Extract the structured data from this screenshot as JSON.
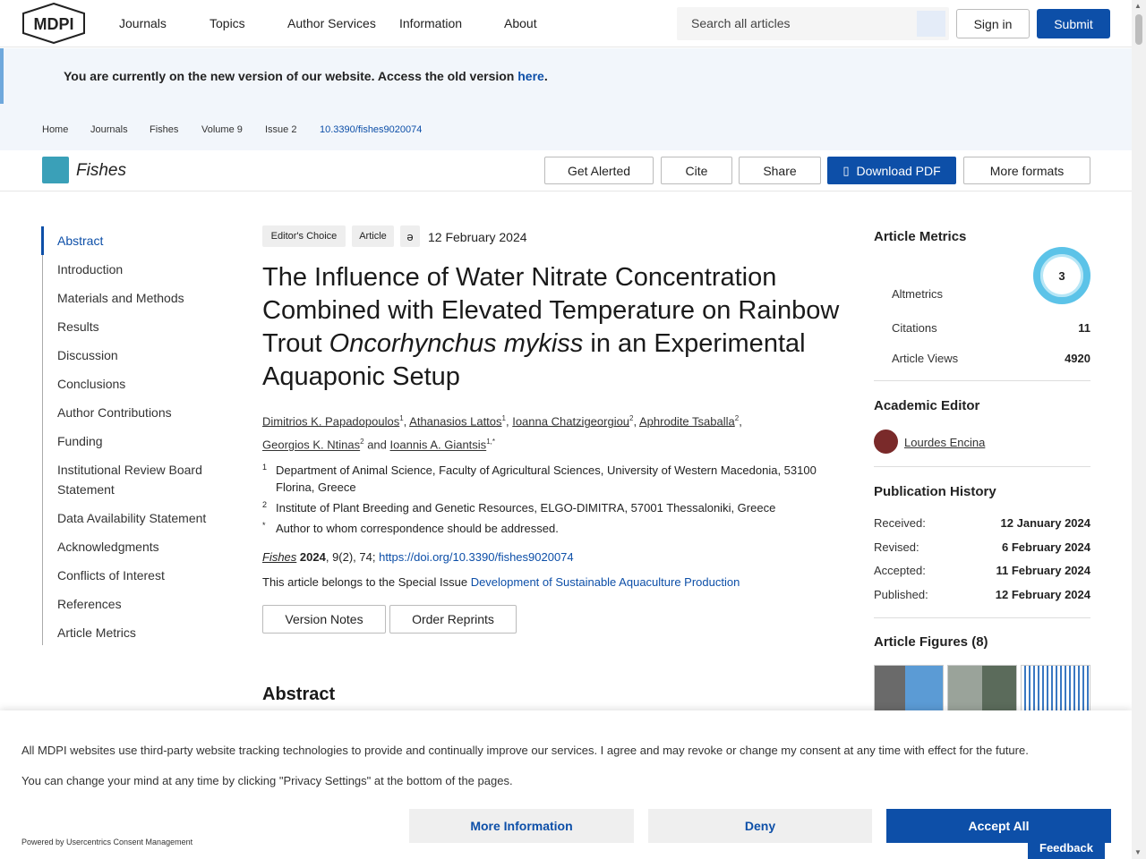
{
  "header": {
    "logo": "MDPI",
    "nav": [
      "Journals",
      "Topics",
      "Author Services",
      "Information",
      "About"
    ],
    "search_placeholder": "Search all articles",
    "signin": "Sign in",
    "submit": "Submit"
  },
  "notice": {
    "text": "You are currently on the new version of our website. Access the old version ",
    "link": "here",
    "end": "."
  },
  "breadcrumb": [
    "Home",
    "Journals",
    "Fishes",
    "Volume 9",
    "Issue 2",
    "10.3390/fishes9020074"
  ],
  "journal": {
    "name": "Fishes",
    "buttons": {
      "alert": "Get Alerted",
      "cite": "Cite",
      "share": "Share",
      "pdf": "Download PDF",
      "formats": "More formats"
    }
  },
  "toc": [
    "Abstract",
    "Introduction",
    "Materials and Methods",
    "Results",
    "Discussion",
    "Conclusions",
    "Author Contributions",
    "Funding",
    "Institutional Review Board Statement",
    "Data Availability Statement",
    "Acknowledgments",
    "Conflicts of Interest",
    "References",
    "Article Metrics"
  ],
  "article": {
    "tag1": "Editor's Choice",
    "tag2": "Article",
    "date": "12 February 2024",
    "title_a": "The Influence of Water Nitrate Concentration Combined with Elevated Temperature on Rainbow Trout ",
    "title_italic": "Oncorhynchus mykiss",
    "title_b": " in an Experimental Aquaponic Setup",
    "authors": [
      {
        "name": "Dimitrios K. Papadopoulos",
        "sup": "1"
      },
      {
        "name": "Athanasios Lattos",
        "sup": "1"
      },
      {
        "name": "Ioanna Chatzigeorgiou",
        "sup": "2"
      },
      {
        "name": "Aphrodite Tsaballa",
        "sup": "2"
      },
      {
        "name": "Georgios K. Ntinas",
        "sup": "2"
      },
      {
        "name": "Ioannis A. Giantsis",
        "sup": "1,*"
      }
    ],
    "and": "and",
    "affiliations": [
      {
        "num": "1",
        "text": "Department of Animal Science, Faculty of Agricultural Sciences, University of Western Macedonia, 53100 Florina, Greece"
      },
      {
        "num": "2",
        "text": "Institute of Plant Breeding and Genetic Resources, ELGO-DIMITRA, 57001 Thessaloniki, Greece"
      },
      {
        "num": "*",
        "text": "Author to whom correspondence should be addressed."
      }
    ],
    "cite_journal": "Fishes",
    "cite_year": "2024",
    "cite_rest": ", 9(2), 74; ",
    "cite_doi": "https://doi.org/10.3390/fishes9020074",
    "special_prefix": "This article belongs to the Special Issue ",
    "special_issue": "Development of Sustainable Aquaculture Production",
    "version_notes": "Version Notes",
    "order_reprints": "Order Reprints",
    "abstract_heading": "Abstract"
  },
  "metrics": {
    "heading": "Article Metrics",
    "altmetrics_label": "Altmetrics",
    "altmetric_score": "3",
    "citations_label": "Citations",
    "citations": "11",
    "views_label": "Article Views",
    "views": "4920"
  },
  "editor": {
    "heading": "Academic Editor",
    "name": "Lourdes Encina"
  },
  "history": {
    "heading": "Publication History",
    "rows": [
      {
        "label": "Received:",
        "value": "12 January 2024"
      },
      {
        "label": "Revised:",
        "value": "6 February 2024"
      },
      {
        "label": "Accepted:",
        "value": "11 February 2024"
      },
      {
        "label": "Published:",
        "value": "12 February 2024"
      }
    ]
  },
  "figures": {
    "heading": "Article Figures (8)"
  },
  "consent": {
    "line1": "All MDPI websites use third-party website tracking technologies to provide and continually improve our services. I agree and may revoke or change my consent at any time with effect for the future.",
    "line2": "You can change your mind at any time by clicking \"Privacy Settings\" at the bottom of the pages.",
    "powered": "Powered by Usercentrics Consent Management",
    "more": "More Information",
    "deny": "Deny",
    "accept": "Accept All",
    "feedback": "Feedback"
  },
  "colors": {
    "brand": "#0d4fa8",
    "notice_bg": "#f2f6fb"
  }
}
